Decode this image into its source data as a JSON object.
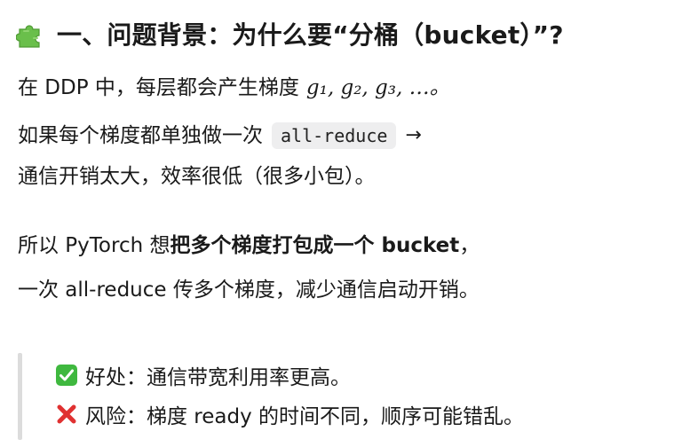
{
  "heading": {
    "icon": "puzzle-piece-icon",
    "text": "一、问题背景：为什么要“分桶（bucket）”?"
  },
  "paragraph1": {
    "line1_text": "在 DDP 中，每层都会产生梯度",
    "line1_math": "g₁, g₂, g₃, …。",
    "line2_text": "如果每个梯度都单独做一次",
    "line2_code": "all-reduce",
    "line2_arrow": "→",
    "line3_text": "通信开销太大，效率很低（很多小包）。"
  },
  "paragraph2": {
    "line1_prefix": "所以 PyTorch 想 ",
    "line1_bold": "把多个梯度打包成一个 bucket",
    "line1_suffix": "，",
    "line2_text": "一次 all-reduce 传多个梯度，减少通信启动开销。"
  },
  "quote": {
    "pro_icon": "check-mark-icon",
    "pro_text": "好处：通信带宽利用率更高。",
    "con_icon": "cross-mark-icon",
    "con_text": "风险：梯度 ready 的时间不同，顺序可能错乱。"
  },
  "colors": {
    "text": "#1a1a1a",
    "code_bg": "#eeeeef",
    "quote_bar": "#dcdcdc",
    "check_green": "#3fb83f",
    "cross_red": "#e03131",
    "puzzle_green": "#6abf4b"
  }
}
